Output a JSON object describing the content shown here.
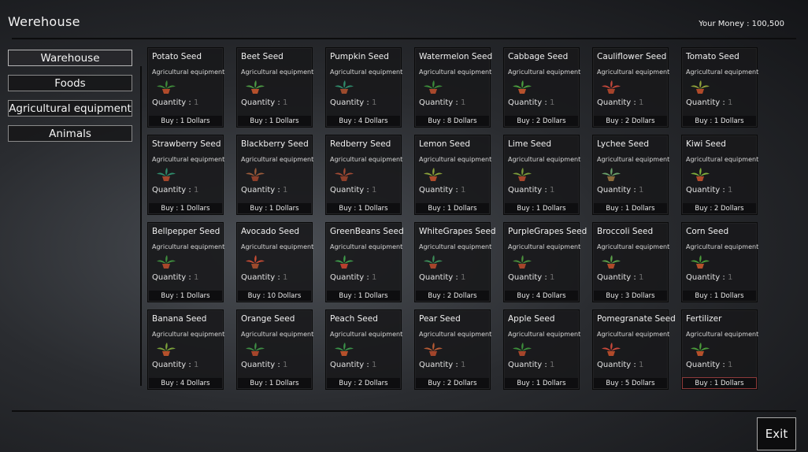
{
  "header": {
    "title": "Werehouse",
    "money": "Your Money : 100,500"
  },
  "sidebar": [
    {
      "label": "Warehouse",
      "active": true
    },
    {
      "label": "Foods"
    },
    {
      "label": "Agricultural equipment"
    },
    {
      "label": "Animals"
    }
  ],
  "card_labels": {
    "quantity_label": "Quantity : ",
    "category": "Agricultural equipment"
  },
  "items": [
    {
      "name": "Potato Seed",
      "quantity": "1",
      "buy": "Buy : 1 Dollars",
      "leaf": "#3e8a3a",
      "pot": "#b04a2a"
    },
    {
      "name": "Beet Seed",
      "quantity": "1",
      "buy": "Buy : 1 Dollars",
      "leaf": "#4c9a44",
      "pot": "#b5502b"
    },
    {
      "name": "Pumpkin Seed",
      "quantity": "1",
      "buy": "Buy : 4 Dollars",
      "leaf": "#2f8a6a",
      "pot": "#9c4a2c"
    },
    {
      "name": "Watermelon Seed",
      "quantity": "1",
      "buy": "Buy : 8 Dollars",
      "leaf": "#3c8c3a",
      "pot": "#a8482b"
    },
    {
      "name": "Cabbage Seed",
      "quantity": "1",
      "buy": "Buy : 2 Dollars",
      "leaf": "#4a9e3e",
      "pot": "#b6512c"
    },
    {
      "name": "Cauliflower Seed",
      "quantity": "1",
      "buy": "Buy : 2 Dollars",
      "leaf": "#c2473a",
      "pot": "#a6432b"
    },
    {
      "name": "Tomato Seed",
      "quantity": "1",
      "buy": "Buy : 1 Dollars",
      "leaf": "#8fa13a",
      "pot": "#b04a2a"
    },
    {
      "name": "Strawberry Seed",
      "quantity": "1",
      "buy": "Buy : 1 Dollars",
      "leaf": "#2f8c6c",
      "pot": "#a2452b"
    },
    {
      "name": "Blackberry Seed",
      "quantity": "1",
      "buy": "Buy : 1 Dollars",
      "leaf": "#9a5a3a",
      "pot": "#8c3e2a"
    },
    {
      "name": "Redberry Seed",
      "quantity": "1",
      "buy": "Buy : 1 Dollars",
      "leaf": "#a24a34",
      "pot": "#8c3e2a"
    },
    {
      "name": "Lemon Seed",
      "quantity": "1",
      "buy": "Buy : 1 Dollars",
      "leaf": "#8aa03a",
      "pot": "#ad4a2a"
    },
    {
      "name": "Lime Seed",
      "quantity": "1",
      "buy": "Buy : 1 Dollars",
      "leaf": "#7a9a3a",
      "pot": "#a6452b"
    },
    {
      "name": "Lychee Seed",
      "quantity": "1",
      "buy": "Buy : 1 Dollars",
      "leaf": "#6aa06a",
      "pot": "#8a6a3a"
    },
    {
      "name": "Kiwi Seed",
      "quantity": "1",
      "buy": "Buy : 2 Dollars",
      "leaf": "#7fae3c",
      "pot": "#b04a2a"
    },
    {
      "name": "Bellpepper Seed",
      "quantity": "1",
      "buy": "Buy : 1 Dollars",
      "leaf": "#3f8e3e",
      "pot": "#a9472b"
    },
    {
      "name": "Avocado Seed",
      "quantity": "1",
      "buy": "Buy : 10 Dollars",
      "leaf": "#c84c34",
      "pot": "#9c4a2c"
    },
    {
      "name": "GreenBeans Seed",
      "quantity": "1",
      "buy": "Buy : 1 Dollars",
      "leaf": "#3e9a4a",
      "pot": "#b8402e"
    },
    {
      "name": "WhiteGrapes Seed",
      "quantity": "1",
      "buy": "Buy : 2 Dollars",
      "leaf": "#3c8c58",
      "pot": "#a6452b"
    },
    {
      "name": "PurpleGrapes Seed",
      "quantity": "1",
      "buy": "Buy : 4 Dollars",
      "leaf": "#4a8e3c",
      "pot": "#a6452b"
    },
    {
      "name": "Broccoli Seed",
      "quantity": "1",
      "buy": "Buy : 3 Dollars",
      "leaf": "#5ca04a",
      "pot": "#b04a2a"
    },
    {
      "name": "Corn Seed",
      "quantity": "1",
      "buy": "Buy : 1 Dollars",
      "leaf": "#4a9a3a",
      "pot": "#b5502b"
    },
    {
      "name": "Banana Seed",
      "quantity": "1",
      "buy": "Buy : 4 Dollars",
      "leaf": "#7aa03a",
      "pot": "#b5502b"
    },
    {
      "name": "Orange Seed",
      "quantity": "1",
      "buy": "Buy : 1 Dollars",
      "leaf": "#3e8c44",
      "pot": "#a6452b"
    },
    {
      "name": "Peach Seed",
      "quantity": "1",
      "buy": "Buy : 2 Dollars",
      "leaf": "#3a9048",
      "pot": "#b5502b"
    },
    {
      "name": "Pear Seed",
      "quantity": "1",
      "buy": "Buy : 2 Dollars",
      "leaf": "#b65a34",
      "pot": "#a2452b"
    },
    {
      "name": "Apple Seed",
      "quantity": "1",
      "buy": "Buy : 1 Dollars",
      "leaf": "#3c8c3a",
      "pot": "#a6452b"
    },
    {
      "name": "Pomegranate Seed",
      "quantity": "1",
      "buy": "Buy : 5 Dollars",
      "leaf": "#c8483a",
      "pot": "#b04a2a"
    },
    {
      "name": "Fertilizer",
      "quantity": "1",
      "buy": "Buy : 1 Dollars",
      "leaf": "#4a9a3a",
      "pot": "#b5502b",
      "highlight": true
    }
  ],
  "exit_label": "Exit"
}
